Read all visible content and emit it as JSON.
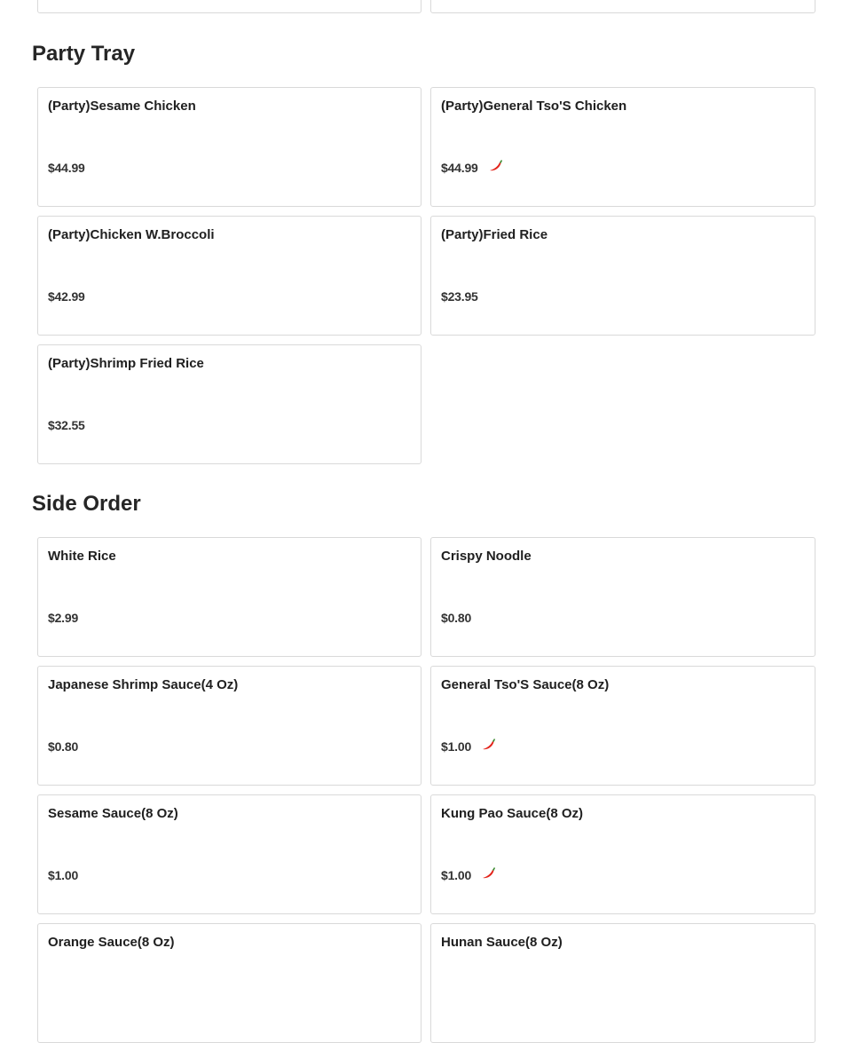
{
  "sections": [
    {
      "title": "Party Tray",
      "items": [
        {
          "name": "(Party)Sesame Chicken",
          "price": "$44.99",
          "spicy": false
        },
        {
          "name": "(Party)General Tso'S Chicken",
          "price": "$44.99",
          "spicy": true
        },
        {
          "name": "(Party)Chicken W.Broccoli",
          "price": "$42.99",
          "spicy": false
        },
        {
          "name": "(Party)Fried Rice",
          "price": "$23.95",
          "spicy": false
        },
        {
          "name": "(Party)Shrimp Fried Rice",
          "price": "$32.55",
          "spicy": false
        }
      ]
    },
    {
      "title": "Side Order",
      "items": [
        {
          "name": "White Rice",
          "price": "$2.99",
          "spicy": false
        },
        {
          "name": "Crispy Noodle",
          "price": "$0.80",
          "spicy": false
        },
        {
          "name": "Japanese Shrimp Sauce(4 Oz)",
          "price": "$0.80",
          "spicy": false
        },
        {
          "name": "General Tso'S Sauce(8 Oz)",
          "price": "$1.00",
          "spicy": true
        },
        {
          "name": "Sesame Sauce(8 Oz)",
          "price": "$1.00",
          "spicy": false
        },
        {
          "name": "Kung Pao Sauce(8 Oz)",
          "price": "$1.00",
          "spicy": true
        },
        {
          "name": "Orange Sauce(8 Oz)",
          "price": "",
          "spicy": false
        },
        {
          "name": "Hunan Sauce(8 Oz)",
          "price": "",
          "spicy": true
        }
      ]
    }
  ],
  "icons": {
    "spicy": "chili-pepper-icon"
  },
  "colors": {
    "chili": "#e3241b",
    "border": "#d9d9d9"
  }
}
